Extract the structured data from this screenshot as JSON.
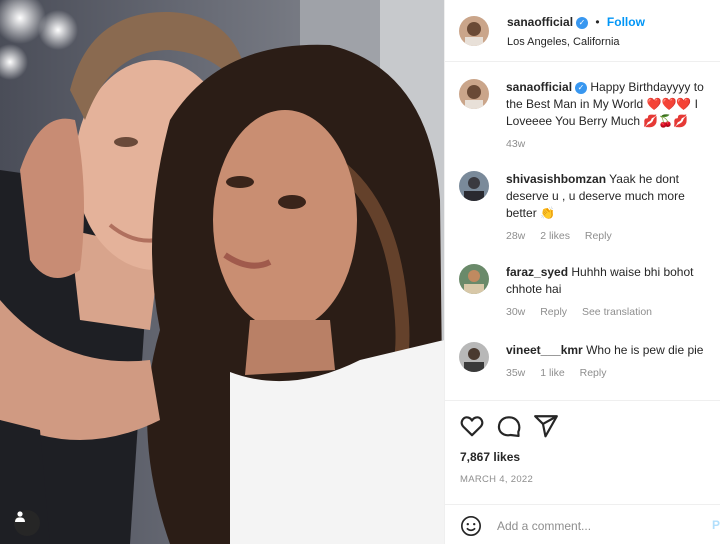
{
  "post": {
    "username": "sanaofficial",
    "follow_label": "Follow",
    "location": "Los Angeles, California"
  },
  "caption": {
    "username": "sanaofficial",
    "text": "Happy Birthdayyyy to the Best Man in My World ❤️❤️❤️ I Loveeee You Berry Much 💋🍒💋",
    "age": "43w"
  },
  "comments": [
    {
      "username": "shivasishbomzan",
      "text": "Yaak he dont deserve u , u deserve much more better 👏",
      "age": "28w",
      "likes": "2 likes",
      "reply": "Reply"
    },
    {
      "username": "faraz_syed",
      "text": "Huhhh waise bhi bohot chhote hai",
      "age": "30w",
      "reply": "Reply",
      "translate": "See translation"
    },
    {
      "username": "vineet___kmr",
      "text": "Who he is pew die pie",
      "age": "35w",
      "likes": "1 like",
      "reply": "Reply"
    }
  ],
  "stats": {
    "likes": "7,867 likes",
    "date": "MARCH 4, 2022"
  },
  "composer": {
    "placeholder": "Add a comment...",
    "post_label": "P"
  },
  "icons": [
    "heart-icon",
    "comment-icon",
    "share-icon",
    "emoji-icon",
    "user-tag-icon",
    "verified-icon"
  ],
  "colors": {
    "accent": "#0095f6",
    "verified": "#3897f0",
    "text": "#262626",
    "muted": "#8e8e8e"
  }
}
